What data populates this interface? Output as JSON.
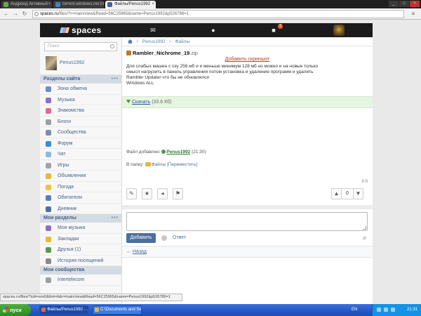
{
  "browser": {
    "tabs": [
      {
        "label": "Андроид Активный",
        "color": "#6aa84f",
        "active": false
      },
      {
        "label": "torrent-windows.net | Бесплатно",
        "color": "#3d85c6",
        "active": false
      },
      {
        "label": "Файлы/Penus1992",
        "color": "#4a5f9a",
        "active": true
      }
    ],
    "url_site": "spaces.ru",
    "url_path": "/files/?r=main/view&Read=56C25965&name=Penus1992&p526786=1"
  },
  "header": {
    "logo_text": "spaces",
    "notification_count": "2"
  },
  "sidebar": {
    "search_placeholder": "Поиск",
    "user_name": "Penus1992",
    "section_site": "Разделы сайта",
    "site_items": [
      {
        "label": "Зона обмена",
        "color": "#6b8fc7"
      },
      {
        "label": "Музыка",
        "color": "#8e6fc4"
      },
      {
        "label": "Знакомства",
        "color": "#e06a8c"
      },
      {
        "label": "Блоги",
        "color": "#9aa0a8"
      },
      {
        "label": "Сообщества",
        "color": "#7b8ea9"
      },
      {
        "label": "Форум",
        "color": "#3b8bd6"
      },
      {
        "label": "Чат",
        "color": "#8fb9e0"
      },
      {
        "label": "Игры",
        "color": "#a0a6ae"
      },
      {
        "label": "Объявления",
        "color": "#e6b83a"
      },
      {
        "label": "Погода",
        "color": "#f0c24a"
      },
      {
        "label": "Обитатели",
        "color": "#5a7fb5"
      },
      {
        "label": "Дневник",
        "color": "#4f6ea2"
      }
    ],
    "section_my": "Мои разделы",
    "my_items": [
      {
        "label": "Моя музыка",
        "color": "#8e6fc4"
      },
      {
        "label": "Закладки",
        "color": "#e6b83a"
      },
      {
        "label": "Друзья (1)",
        "color": "#5a9a4a"
      },
      {
        "label": "История посещений",
        "color": "#8a8a8a"
      }
    ],
    "section_comm": "Мои сообщества",
    "comm_items": [
      {
        "label": "Intertelecom",
        "color": "#9aa0a8"
      }
    ]
  },
  "content": {
    "breadcrumbs": [
      "Penus1992",
      "Файлы"
    ],
    "file_name": "Rambler_Nichrome_19",
    "file_ext": ".zip",
    "add_screenshot": "Добавить скриншот",
    "description": [
      "Для слабых машин с озу 256 мб и и меньше минимум 128 мб но можно и на новые только",
      "смысл нагрузить в панель управления потом установка и удаление программ и удалить",
      "Rambler Updater что бы не обновлялся",
      "Windows ALL"
    ],
    "download_label": "Скачать",
    "download_size": "(33.6 Кб)",
    "added_label": "Файл добавлен:",
    "added_user": "Penus1992",
    "added_time": "(21:30)",
    "folder_label": "В папку:",
    "folder_name": "Файлы",
    "move_label": "[Переместить]",
    "counts": "0 0",
    "vote_value": "0",
    "send_label": "Добавить",
    "reply_label": "Ответ",
    "back_label": "Назад"
  },
  "status_url": "spaces.ru/files/?sid=ooo0&link=b&r=main/view&Read=56C25965&name=Penus1992&p526786=1",
  "taskbar": {
    "start": "пуск",
    "items": [
      {
        "label": "Файлы/Penus1992 - ...",
        "color": "#e06a3a",
        "active": true
      },
      {
        "label": "C:\\Documents and Se...",
        "color": "#e6b83a",
        "active": false
      }
    ],
    "lang": "EN",
    "clock": "21:31"
  }
}
